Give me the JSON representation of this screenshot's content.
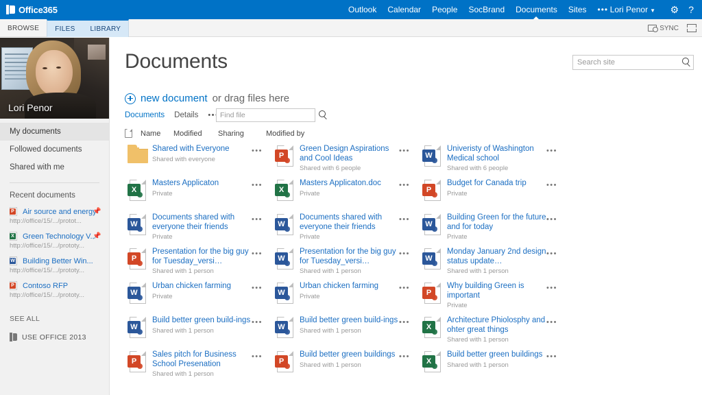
{
  "suite": {
    "brand_prefix": "Office",
    "brand_suffix": "365",
    "nav": [
      {
        "label": "Outlook",
        "active": false
      },
      {
        "label": "Calendar",
        "active": false
      },
      {
        "label": "People",
        "active": false
      },
      {
        "label": "SocBrand",
        "active": false
      },
      {
        "label": "Documents",
        "active": true
      },
      {
        "label": "Sites",
        "active": false
      }
    ],
    "more_label": "•••",
    "user_name": "Lori Penor",
    "user_caret": "▼",
    "settings_icon": "⚙",
    "help_icon": "?",
    "accent_color": "#0072c6"
  },
  "ribbon": {
    "browse_label": "BROWSE",
    "files_label": "FILES",
    "library_label": "LIBRARY",
    "sync_label": "SYNC"
  },
  "sidebar": {
    "persona_name": "Lori Penor",
    "links": [
      {
        "label": "My documents",
        "selected": true
      },
      {
        "label": "Followed documents",
        "selected": false
      },
      {
        "label": "Shared with me",
        "selected": false
      }
    ],
    "recent_title": "Recent documents",
    "recent": [
      {
        "name": "Air source and energy",
        "url": "http://office/15/.../protot...",
        "type": "ppt",
        "pinned": true
      },
      {
        "name": "Green Technology V...",
        "url": "http://office/15/.../prototy...",
        "type": "excel",
        "pinned": true
      },
      {
        "name": "Building Better Win...",
        "url": "http://office/15/.../prototy...",
        "type": "word",
        "pinned": false
      },
      {
        "name": "Contoso RFP",
        "url": "http://office/15/.../prototy...",
        "type": "ppt",
        "pinned": false
      }
    ],
    "see_all_label": "SEE ALL",
    "use_office_label": "USE OFFICE 2013"
  },
  "main": {
    "page_title": "Documents",
    "site_search_placeholder": "Search site",
    "site_search_value": "",
    "new_document_label": "new document",
    "drag_files_label": "or drag files here",
    "subnav": [
      {
        "label": "Documents",
        "active": true
      },
      {
        "label": "Details",
        "active": false
      }
    ],
    "subnav_more": "•••",
    "find_file_placeholder": "Find file",
    "find_file_value": "",
    "columns": [
      "Name",
      "Modified",
      "Sharing",
      "Modified by"
    ],
    "tile_menu_glyph": "•••",
    "tiles": [
      {
        "name": "Shared with Everyone",
        "sub": "Shared with everyone",
        "type": "folder"
      },
      {
        "name": "Green Design Aspirations and Cool Ideas",
        "sub": "Shared with 6 people",
        "type": "ppt"
      },
      {
        "name": "Univeristy of Washington Medical school",
        "sub": "Shared with 6 people",
        "type": "word"
      },
      {
        "name": "Masters Applicaton",
        "sub": "Private",
        "type": "excel"
      },
      {
        "name": "Masters Applicaton.doc",
        "sub": "Private",
        "type": "excel"
      },
      {
        "name": "Budget for Canada trip",
        "sub": "Private",
        "type": "ppt"
      },
      {
        "name": "Documents shared with everyone their friends",
        "sub": "Private",
        "type": "word"
      },
      {
        "name": "Documents shared with everyone their friends",
        "sub": "Private",
        "type": "word"
      },
      {
        "name": "Building Green for the future and for today",
        "sub": "Private",
        "type": "word"
      },
      {
        "name": "Presentation for the big guy for Tuesday_versi…",
        "sub": "Shared with 1 person",
        "type": "ppt"
      },
      {
        "name": "Presentation for the big guy for Tuesday_versi…",
        "sub": "Shared with 1 person",
        "type": "word"
      },
      {
        "name": "Monday January 2nd design status update…",
        "sub": "Shared with 1 person",
        "type": "word"
      },
      {
        "name": "Urban chicken farming",
        "sub": "Private",
        "type": "word"
      },
      {
        "name": "Urban chicken farming",
        "sub": "Private",
        "type": "word"
      },
      {
        "name": "Why building Green is important",
        "sub": "Private",
        "type": "ppt"
      },
      {
        "name": "Build better green build-ings",
        "sub": "Shared with 1 person",
        "type": "word"
      },
      {
        "name": "Build better green build-ings",
        "sub": "Shared with 1 person",
        "type": "word"
      },
      {
        "name": "Architecture Phiolosphy and ohter great things",
        "sub": "Shared with 1 person",
        "type": "excel"
      },
      {
        "name": "Sales pitch for Business School Presenation",
        "sub": "Shared with 1 person",
        "type": "ppt"
      },
      {
        "name": "Build better green buildings",
        "sub": "Shared with 1 person",
        "type": "ppt"
      },
      {
        "name": "Build better green buildings",
        "sub": "Shared with 1 person",
        "type": "excel"
      }
    ]
  }
}
